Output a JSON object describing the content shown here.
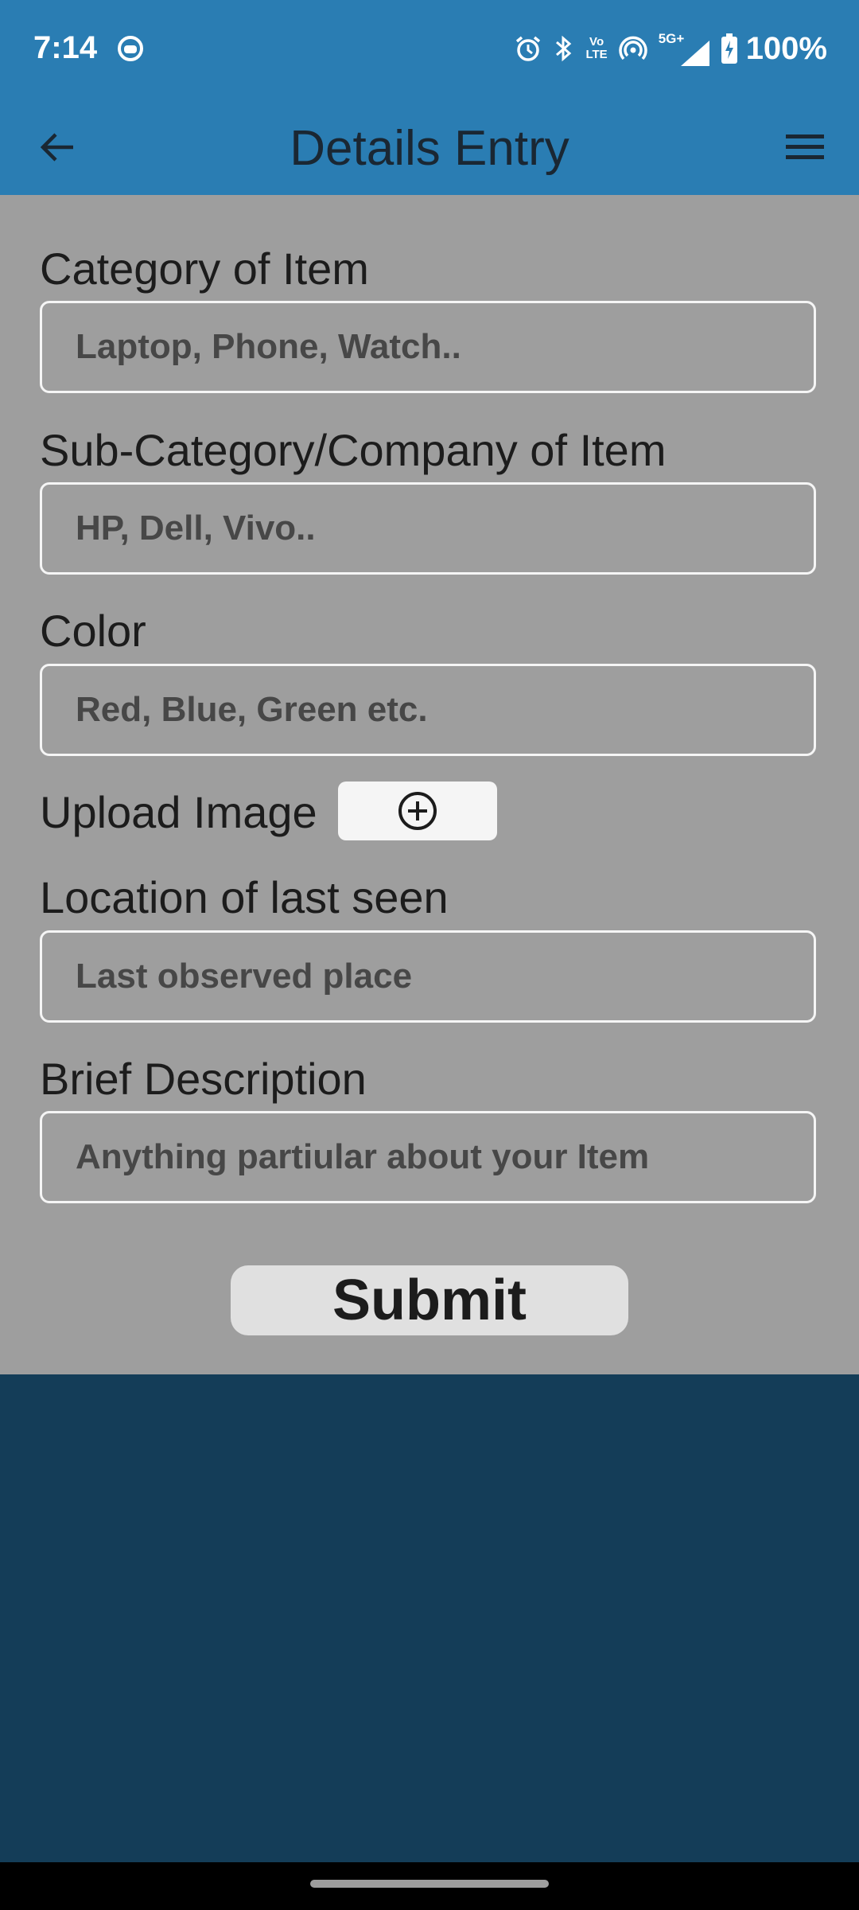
{
  "status_bar": {
    "time": "7:14",
    "icons": [
      "android-face-icon",
      "alarm-icon",
      "bluetooth-icon",
      "volte-icon",
      "hotspot-icon",
      "signal-5g-icon",
      "battery-icon"
    ],
    "volte_top": "Vo",
    "volte_bottom": "LTE",
    "network_label": "5G+",
    "battery": "100%"
  },
  "app_bar": {
    "title": "Details Entry"
  },
  "form": {
    "category": {
      "label": "Category of Item",
      "placeholder": "Laptop, Phone, Watch.."
    },
    "subcategory": {
      "label": "Sub-Category/Company of Item",
      "placeholder": "HP, Dell, Vivo.."
    },
    "color": {
      "label": "Color",
      "placeholder": "Red, Blue, Green etc."
    },
    "upload": {
      "label": "Upload Image"
    },
    "location": {
      "label": "Location of last seen",
      "placeholder": "Last observed place"
    },
    "description": {
      "label": "Brief Description",
      "placeholder": "Anything partiular about your Item"
    },
    "submit_label": "Submit"
  },
  "colors": {
    "app_bar": "#2a7db3",
    "form_background": "#9e9e9e",
    "page_background": "#143d58",
    "input_border": "#f5f5f5",
    "submit_button": "#e0e0e0"
  }
}
